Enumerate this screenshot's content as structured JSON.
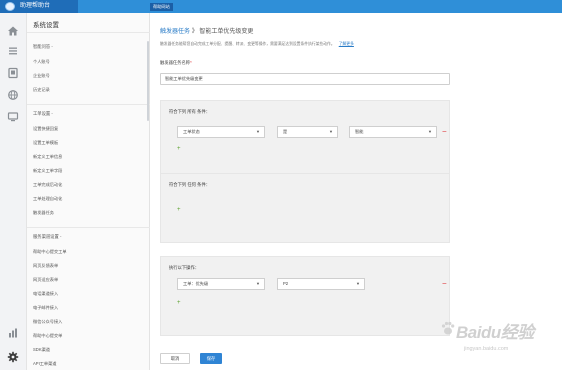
{
  "app": {
    "title": "助理帮助台",
    "top_tab": "帮助网站"
  },
  "sidebar": {
    "title": "系统设置",
    "sections": [
      {
        "label": "智能问答 -",
        "items": [
          "个人账号",
          "企业账号",
          "历史记录"
        ]
      },
      {
        "label": "工单设置 -",
        "items": [
          "设置快捷回复",
          "设置工单模板",
          "新定义工单信息",
          "新定义工单字段",
          "工单完成后动化",
          "工单处理自动化",
          "触发器任务"
        ]
      },
      {
        "label": "服务渠道设置 -",
        "items": [
          "帮助中心提交工单",
          "网页反馈表单",
          "网页适应表单",
          "电话渠道接入",
          "电子邮件接入",
          "微信公众号接入",
          "帮助中心提交单",
          "SDK渠道",
          "API工单渠道"
        ]
      }
    ]
  },
  "main": {
    "breadcrumb_link": "触发器任务",
    "breadcrumb_sep": "》",
    "breadcrumb_current": "智能工单优先级变更",
    "description": "触发器任务能帮您自动完成工单分配、提醒、转派、变更等操作，需要满足达到设置条件执行某些动作。",
    "description_link": "了解更多",
    "name_label": "触发器任务名称",
    "name_required": "*",
    "name_value": "智能工单优先级变更",
    "condition_all": {
      "title": "符合下列 所有 条件：",
      "field": "工单状态",
      "operator": "是",
      "value": "智能"
    },
    "condition_any": {
      "title": "符合下列 任何 条件："
    },
    "actions": {
      "title": "执行以下操作：",
      "field": "工单：优先级",
      "value": "P2"
    },
    "cancel_label": "取消",
    "save_label": "保存"
  },
  "watermark": {
    "text": "Baidu经验",
    "url": "jingyan.baidu.com"
  },
  "colors": {
    "topbar": "#2f8fd8",
    "brand": "#1f6db8",
    "link": "#2a7cc7",
    "primary": "#2f84d4",
    "danger": "#e0383a",
    "add": "#5aa02c"
  },
  "icons": [
    "home-icon",
    "list-icon",
    "book-icon",
    "globe-icon",
    "monitor-icon",
    "chart-icon",
    "gear-icon",
    "chevron-down-icon",
    "remove-icon",
    "add-icon"
  ]
}
